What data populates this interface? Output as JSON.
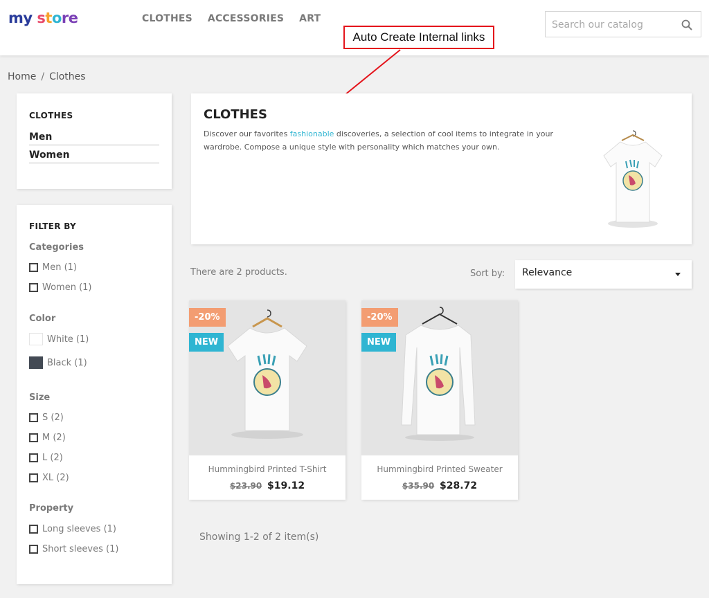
{
  "header": {
    "logo": {
      "part1": "my",
      "part2": " s",
      "part3": "t",
      "part4": "o",
      "part5": "re"
    },
    "nav": [
      "CLOTHES",
      "ACCESSORIES",
      "ART"
    ],
    "search": {
      "placeholder": "Search our catalog",
      "value": ""
    }
  },
  "annotation": {
    "label": "Auto Create Internal links",
    "color": "#e4141b"
  },
  "breadcrumb": {
    "items": [
      "Home",
      "Clothes"
    ],
    "separator": "/"
  },
  "sidebar": {
    "category_title": "CLOTHES",
    "subcategories": [
      "Men",
      "Women"
    ],
    "filter_title": "FILTER BY",
    "facets": {
      "categories": {
        "title": "Categories",
        "items": [
          "Men (1)",
          "Women (1)"
        ]
      },
      "color": {
        "title": "Color",
        "items": [
          {
            "label": "White (1)",
            "swatch": "#ffffff"
          },
          {
            "label": "Black (1)",
            "swatch": "#434a54"
          }
        ]
      },
      "size": {
        "title": "Size",
        "items": [
          "S (2)",
          "M (2)",
          "L (2)",
          "XL (2)"
        ]
      },
      "property": {
        "title": "Property",
        "items": [
          "Long sleeves (1)",
          "Short sleeves (1)"
        ]
      }
    }
  },
  "category": {
    "title": "CLOTHES",
    "desc_before": "Discover our favorites ",
    "desc_link": "fashionable",
    "desc_after": " discoveries, a selection of cool items to integrate in your wardrobe. Compose a unique style with personality which matches your own."
  },
  "listing": {
    "count_text": "There are 2 products.",
    "sort_label": "Sort by:",
    "sort_value": "Relevance",
    "showing": "Showing 1-2 of 2 item(s)"
  },
  "products": [
    {
      "name": "Hummingbird Printed T-Shirt",
      "old_price": "$23.90",
      "price": "$19.12",
      "discount": "-20%",
      "flag": "NEW"
    },
    {
      "name": "Hummingbird Printed Sweater",
      "old_price": "$35.90",
      "price": "$28.72",
      "discount": "-20%",
      "flag": "NEW"
    }
  ],
  "colors": {
    "accent": "#2fb5d2",
    "discount_flag": "#f39d72",
    "new_flag": "#2fb5d2"
  }
}
